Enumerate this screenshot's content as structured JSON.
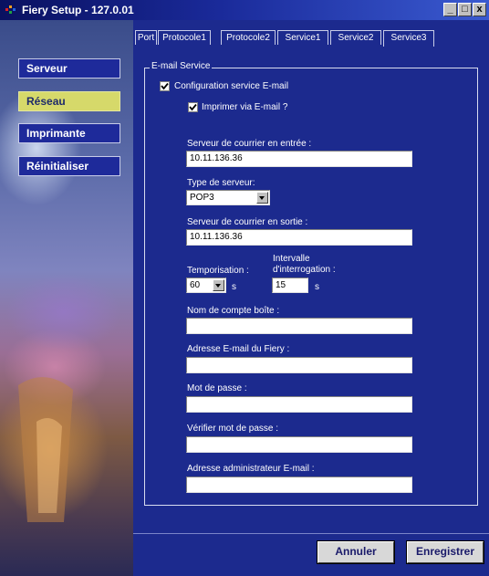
{
  "window": {
    "title": "Fiery Setup - 127.0.01"
  },
  "sidebar": {
    "items": [
      {
        "label": "Serveur"
      },
      {
        "label": "Réseau"
      },
      {
        "label": "Imprimante"
      },
      {
        "label": "Réinitialiser"
      }
    ],
    "active": "Réseau"
  },
  "tabs": [
    {
      "label": "Port"
    },
    {
      "label": "Protocole1"
    },
    {
      "label": "Protocole2"
    },
    {
      "label": "Service1"
    },
    {
      "label": "Service2"
    },
    {
      "label": "Service3"
    }
  ],
  "active_tab": "Service3",
  "email": {
    "group_title": "E-mail Service",
    "config_label": "Configuration service E-mail",
    "config_checked": true,
    "print_label": "Imprimer via E-mail ?",
    "print_checked": true,
    "incoming_label": "Serveur de courrier en entrée :",
    "incoming_value": "10.11.136.36",
    "server_type_label": "Type de serveur:",
    "server_type_value": "POP3",
    "outgoing_label": "Serveur de courrier en sortie :",
    "outgoing_value": "10.11.136.36",
    "timeout_label": "Temporisation :",
    "timeout_value": "60",
    "timeout_unit": "s",
    "interval_label_1": "Intervalle",
    "interval_label_2": "d'interrogation :",
    "interval_value": "15",
    "interval_unit": "s",
    "account_label": "Nom de compte boîte :",
    "account_value": "",
    "fiery_email_label": "Adresse E-mail du Fiery :",
    "fiery_email_value": "",
    "password_label": "Mot de passe :",
    "password_value": "",
    "verify_password_label": "Vérifier mot de passe :",
    "verify_password_value": "",
    "admin_email_label": "Adresse administrateur E-mail :",
    "admin_email_value": ""
  },
  "buttons": {
    "cancel": "Annuler",
    "save": "Enregistrer"
  },
  "colors": {
    "panel": "#1c2a8e",
    "active_nav": "#d6d96a",
    "title_bar": "#0a1160"
  },
  "icons": {
    "app": "fiery-logo-icon",
    "minimize": "minimize-icon",
    "maximize": "maximize-icon",
    "close": "close-icon"
  }
}
